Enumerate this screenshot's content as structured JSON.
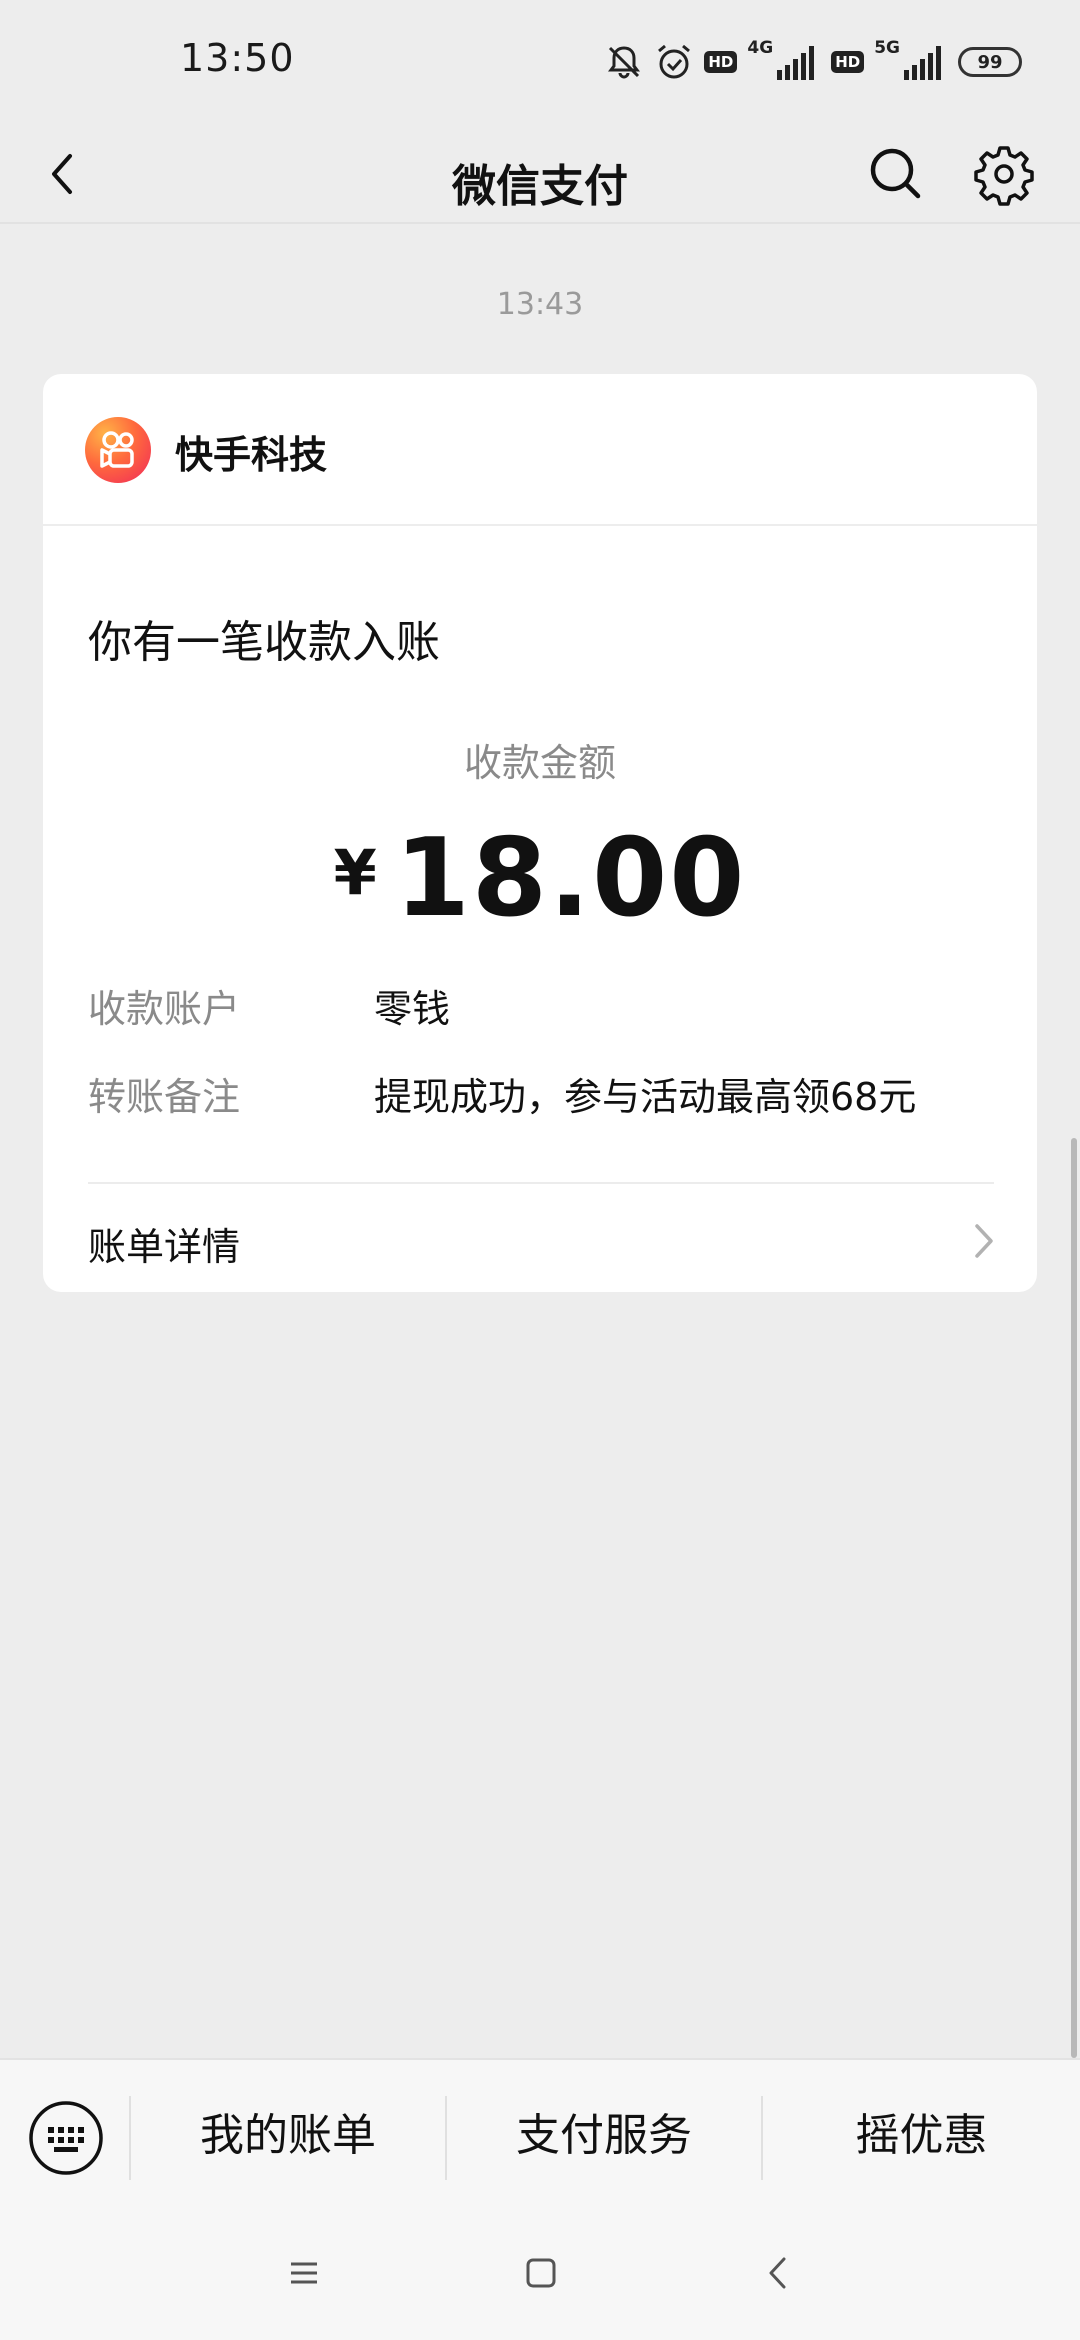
{
  "status_bar": {
    "time": "13:50",
    "hd1": "HD",
    "net1": "4G",
    "hd2": "HD",
    "net2": "5G",
    "battery": "99",
    "icons": [
      "bell-muted-icon",
      "alarm-icon",
      "signal-icon",
      "signal-icon"
    ]
  },
  "nav": {
    "title": "微信支付",
    "back_icon": "back-arrow-icon",
    "search_icon": "search-icon",
    "settings_icon": "gear-icon"
  },
  "message": {
    "time": "13:43",
    "brand_name": "快手科技",
    "brand_icon": "kuaishou-logo-icon",
    "title": "你有一笔收款入账",
    "amount_label": "收款金额",
    "currency": "¥",
    "amount": "18.00",
    "rows": [
      {
        "label": "收款账户",
        "value": "零钱"
      },
      {
        "label": "转账备注",
        "value": "提现成功，参与活动最高领68元"
      }
    ],
    "details_label": "账单详情"
  },
  "bottom_menu": {
    "items": [
      "我的账单",
      "支付服务",
      "摇优惠"
    ]
  },
  "colors": {
    "background": "#ededed",
    "card": "#ffffff",
    "muted_text": "#8a8a8a",
    "brand_gradient_start": "#ffb347",
    "brand_gradient_end": "#f0285a"
  }
}
